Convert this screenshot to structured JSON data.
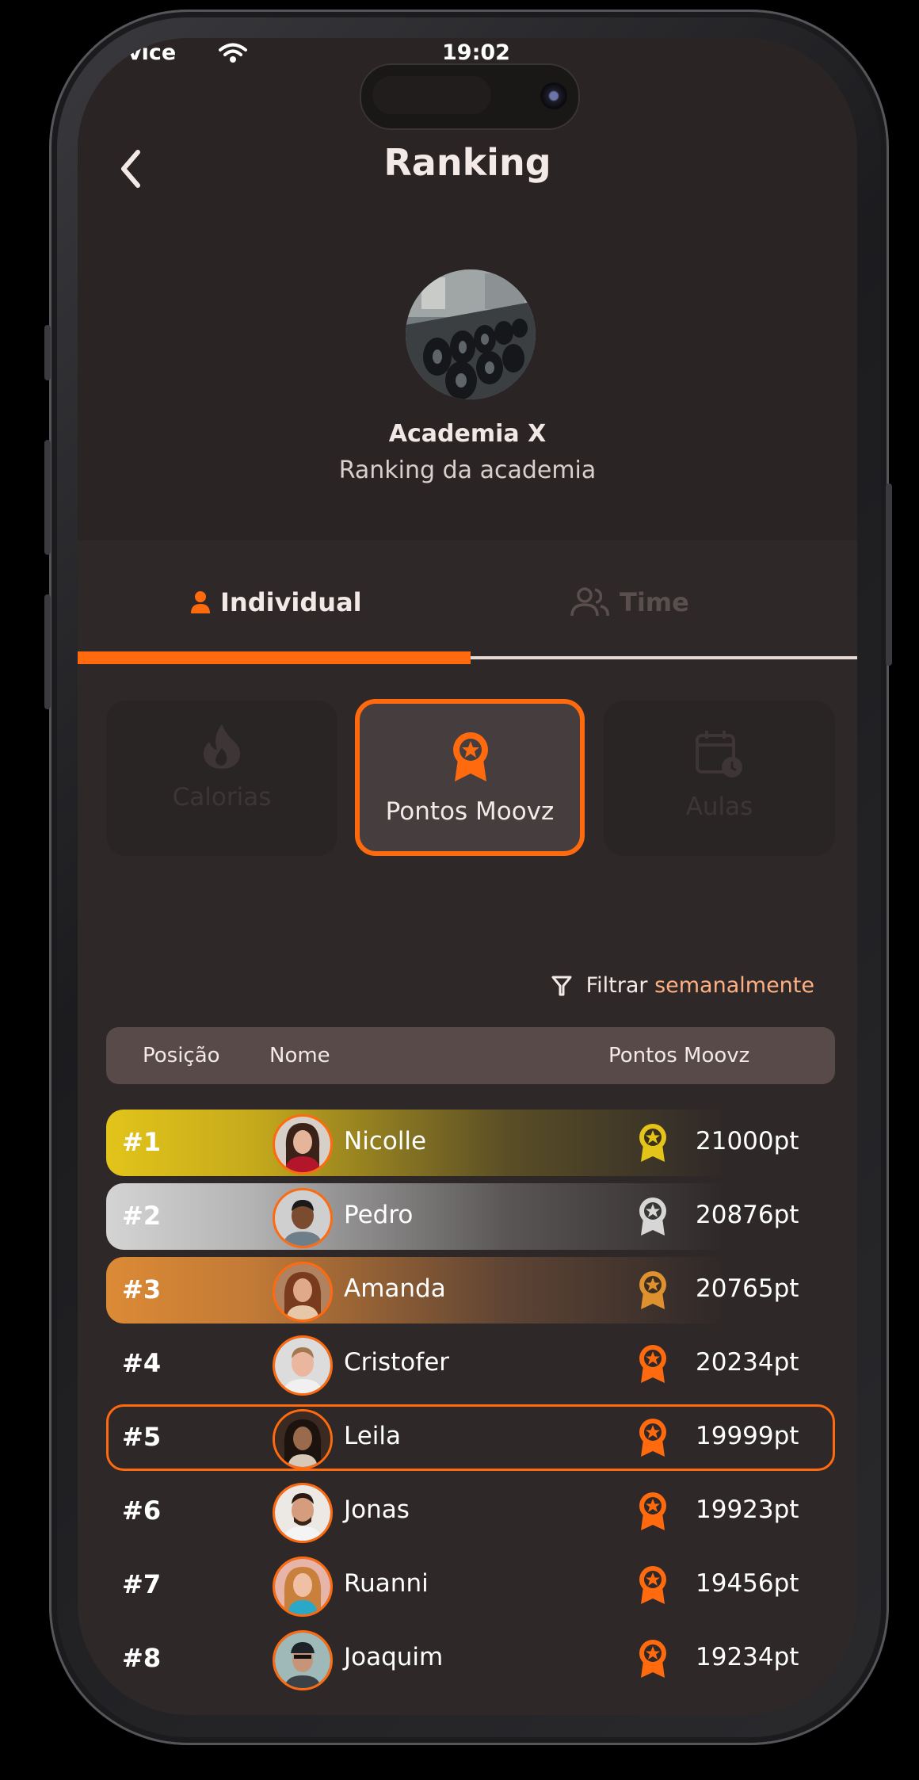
{
  "status": {
    "carrier": "Service",
    "time": "19:02"
  },
  "header": {
    "title": "Ranking"
  },
  "gym": {
    "name": "Academia X",
    "subtitle": "Ranking da academia"
  },
  "tabs": [
    {
      "label": "Individual",
      "active": true
    },
    {
      "label": "Time",
      "active": false
    }
  ],
  "categories": [
    {
      "label": "Calorias",
      "icon": "flame-icon",
      "active": false
    },
    {
      "label": "Pontos Moovz",
      "icon": "medal-icon",
      "active": true
    },
    {
      "label": "Aulas",
      "icon": "calendar-clock-icon",
      "active": false
    }
  ],
  "filter": {
    "prefix": "Filtrar",
    "value": "semanalmente"
  },
  "table": {
    "headers": {
      "position": "Posição",
      "name": "Nome",
      "points": "Pontos Moovz"
    },
    "rows": [
      {
        "position": "#1",
        "name": "Nicolle",
        "points": "21000pt"
      },
      {
        "position": "#2",
        "name": "Pedro",
        "points": "20876pt"
      },
      {
        "position": "#3",
        "name": "Amanda",
        "points": "20765pt"
      },
      {
        "position": "#4",
        "name": "Cristofer",
        "points": "20234pt"
      },
      {
        "position": "#5",
        "name": "Leila",
        "points": "19999pt"
      },
      {
        "position": "#6",
        "name": "Jonas",
        "points": "19923pt"
      },
      {
        "position": "#7",
        "name": "Ruanni",
        "points": "19456pt"
      },
      {
        "position": "#8",
        "name": "Joaquim",
        "points": "19234pt"
      }
    ]
  },
  "colors": {
    "accent": "#ff6a0f",
    "background": "#2a2424",
    "gold": "#e2c41a",
    "silver": "#d4d4d4",
    "bronze": "#dc8a35"
  }
}
